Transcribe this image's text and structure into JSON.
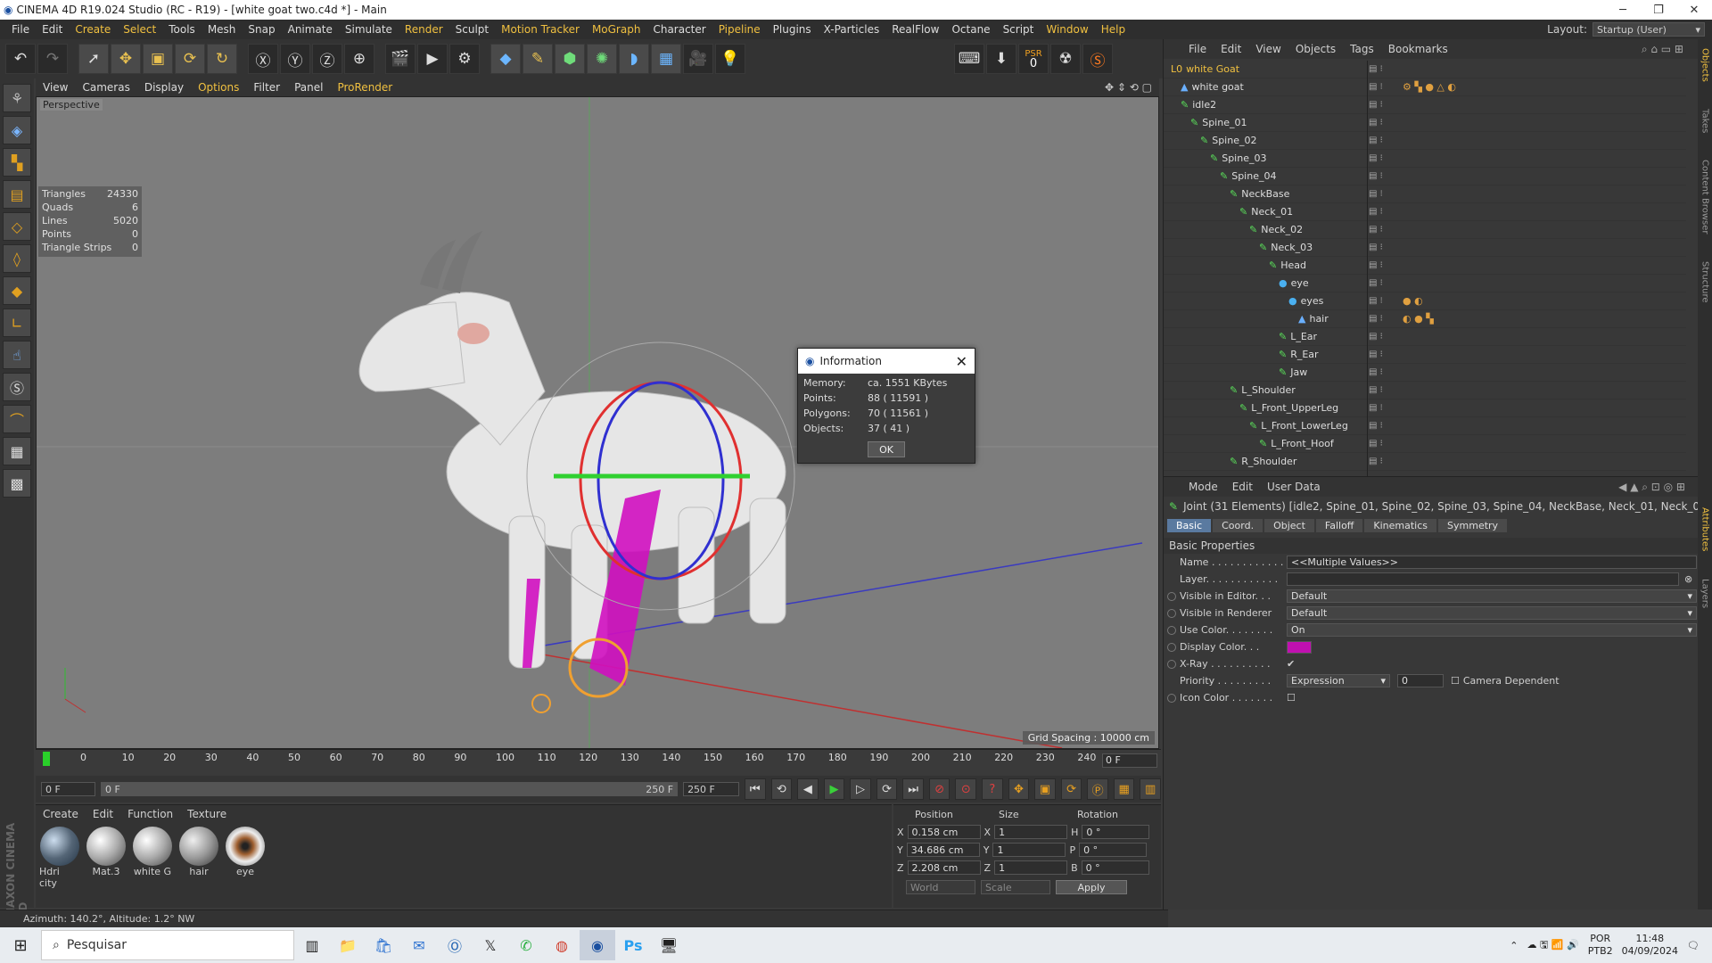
{
  "window": {
    "title": "CINEMA 4D R19.024 Studio (RC - R19) - [white goat two.c4d *] - Main"
  },
  "menu": [
    "File",
    "Edit",
    "Create",
    "Select",
    "Tools",
    "Mesh",
    "Snap",
    "Animate",
    "Simulate",
    "Render",
    "Sculpt",
    "Motion Tracker",
    "MoGraph",
    "Character",
    "Pipeline",
    "Plugins",
    "X-Particles",
    "RealFlow",
    "Octane",
    "Script",
    "Window",
    "Help"
  ],
  "layout": {
    "label": "Layout:",
    "value": "Startup (User)"
  },
  "psr": {
    "label": "PSR",
    "value": "0"
  },
  "viewport": {
    "menu": [
      "View",
      "Cameras",
      "Display",
      "Options",
      "Filter",
      "Panel",
      "ProRender"
    ],
    "label": "Perspective",
    "grid_spacing": "Grid Spacing : 10000 cm",
    "stats": [
      {
        "k": "Triangles",
        "v": "24330"
      },
      {
        "k": "Quads",
        "v": "6"
      },
      {
        "k": "Lines",
        "v": "5020"
      },
      {
        "k": "Points",
        "v": "0"
      },
      {
        "k": "Triangle Strips",
        "v": "0"
      }
    ]
  },
  "dialog": {
    "title": "Information",
    "rows": [
      {
        "k": "Memory:",
        "v": "ca. 1551 KBytes"
      },
      {
        "k": "Points:",
        "v": "88 ( 11591 )"
      },
      {
        "k": "Polygons:",
        "v": "70 ( 11561 )"
      },
      {
        "k": "Objects:",
        "v": "37 ( 41 )"
      }
    ],
    "ok": "OK"
  },
  "timeline": {
    "ticks": [
      "0",
      "10",
      "20",
      "30",
      "40",
      "50",
      "60",
      "70",
      "80",
      "90",
      "100",
      "110",
      "120",
      "130",
      "140",
      "150",
      "160",
      "170",
      "180",
      "190",
      "200",
      "210",
      "220",
      "230",
      "240",
      "250"
    ],
    "current": "0 F",
    "start": "0 F",
    "range_start": "0 F",
    "range_end": "250 F",
    "end": "250 F"
  },
  "materials": {
    "menu": [
      "Create",
      "Edit",
      "Function",
      "Texture"
    ],
    "items": [
      "Hdri city",
      "Mat.3",
      "white G",
      "hair",
      "eye"
    ]
  },
  "coords": {
    "headers": [
      "Position",
      "Size",
      "Rotation"
    ],
    "rows": [
      {
        "a": "X",
        "p": "0.158 cm",
        "b": "X",
        "s": "1",
        "c": "H",
        "r": "0 °"
      },
      {
        "a": "Y",
        "p": "34.686 cm",
        "b": "Y",
        "s": "1",
        "c": "P",
        "r": "0 °"
      },
      {
        "a": "Z",
        "p": "2.208 cm",
        "b": "Z",
        "s": "1",
        "c": "B",
        "r": "0 °"
      }
    ],
    "mode1": "World",
    "mode2": "Scale",
    "apply": "Apply"
  },
  "status": "Azimuth: 140.2°, Altitude: 1.2°  NW",
  "objects": {
    "menu": [
      "File",
      "Edit",
      "View",
      "Objects",
      "Tags",
      "Bookmarks"
    ],
    "tree": [
      {
        "name": "white Goat",
        "lvl": 0,
        "color": "#f0c040"
      },
      {
        "name": "white goat",
        "lvl": 1
      },
      {
        "name": "idle2",
        "lvl": 1
      },
      {
        "name": "Spine_01",
        "lvl": 2
      },
      {
        "name": "Spine_02",
        "lvl": 3
      },
      {
        "name": "Spine_03",
        "lvl": 4
      },
      {
        "name": "Spine_04",
        "lvl": 5
      },
      {
        "name": "NeckBase",
        "lvl": 6
      },
      {
        "name": "Neck_01",
        "lvl": 7
      },
      {
        "name": "Neck_02",
        "lvl": 8
      },
      {
        "name": "Neck_03",
        "lvl": 9
      },
      {
        "name": "Head",
        "lvl": 10
      },
      {
        "name": "eye",
        "lvl": 11
      },
      {
        "name": "eyes",
        "lvl": 12
      },
      {
        "name": "hair",
        "lvl": 13
      },
      {
        "name": "L_Ear",
        "lvl": 11
      },
      {
        "name": "R_Ear",
        "lvl": 11
      },
      {
        "name": "Jaw",
        "lvl": 11
      },
      {
        "name": "L_Shoulder",
        "lvl": 6
      },
      {
        "name": "L_Front_UpperLeg",
        "lvl": 7
      },
      {
        "name": "L_Front_LowerLeg",
        "lvl": 8
      },
      {
        "name": "L_Front_Hoof",
        "lvl": 9
      },
      {
        "name": "R_Shoulder",
        "lvl": 6
      }
    ]
  },
  "attributes": {
    "menu": [
      "Mode",
      "Edit",
      "User Data"
    ],
    "info": "Joint (31 Elements) [idle2, Spine_01, Spine_02, Spine_03, Spine_04, NeckBase, Neck_01, Neck_02, Neck_03, Head",
    "tabs": [
      "Basic",
      "Coord.",
      "Object",
      "Falloff",
      "Kinematics",
      "Symmetry"
    ],
    "section": "Basic Properties",
    "name_label": "Name . . . . . . . . . . . .",
    "name_value": "<<Multiple Values>>",
    "layer_label": "Layer. . . . . . . . . . . .",
    "vis_editor_label": "Visible in Editor. . .",
    "vis_editor": "Default",
    "vis_render_label": "Visible in Renderer",
    "vis_render": "Default",
    "use_color_label": "Use Color. . . . . . . .",
    "use_color": "On",
    "display_color_label": "Display Color. . .",
    "display_color": "#c010b0",
    "xray_label": "X-Ray . . . . . . . . . .",
    "priority_label": "Priority . . . . . . . . .",
    "priority": "Expression",
    "priority_num": "0",
    "camera_dep": "Camera Dependent",
    "icon_color_label": "Icon Color . . . . . . ."
  },
  "sidetabs": [
    "Objects",
    "Takes",
    "Content Browser",
    "Structure",
    "Attributes",
    "Layers"
  ],
  "taskbar": {
    "search": "Pesquisar",
    "lang1": "POR",
    "lang2": "PTB2",
    "time": "11:48",
    "date": "04/09/2024"
  }
}
